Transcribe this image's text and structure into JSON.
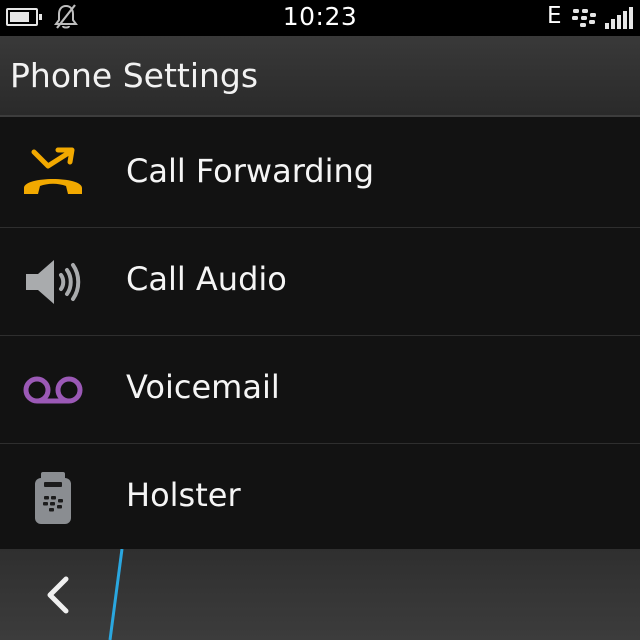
{
  "status_bar": {
    "time": "10:23",
    "network_type": "E",
    "battery_level": 0.8,
    "icons": [
      "battery-icon",
      "notifications-muted-icon",
      "blackberry-logo-icon",
      "signal-strength-icon"
    ]
  },
  "header": {
    "title": "Phone Settings"
  },
  "settings": {
    "items": [
      {
        "label": "Call Forwarding",
        "icon": "call-forwarding-icon",
        "icon_color": "#f2a900"
      },
      {
        "label": "Call Audio",
        "icon": "speaker-icon",
        "icon_color": "#a9abad"
      },
      {
        "label": "Voicemail",
        "icon": "voicemail-icon",
        "icon_color": "#9b59b6"
      },
      {
        "label": "Holster",
        "icon": "holster-icon",
        "icon_color": "#8a8d91"
      }
    ]
  },
  "action_bar": {
    "back_icon": "back-chevron-icon",
    "accent_color": "#2aa7e0"
  }
}
